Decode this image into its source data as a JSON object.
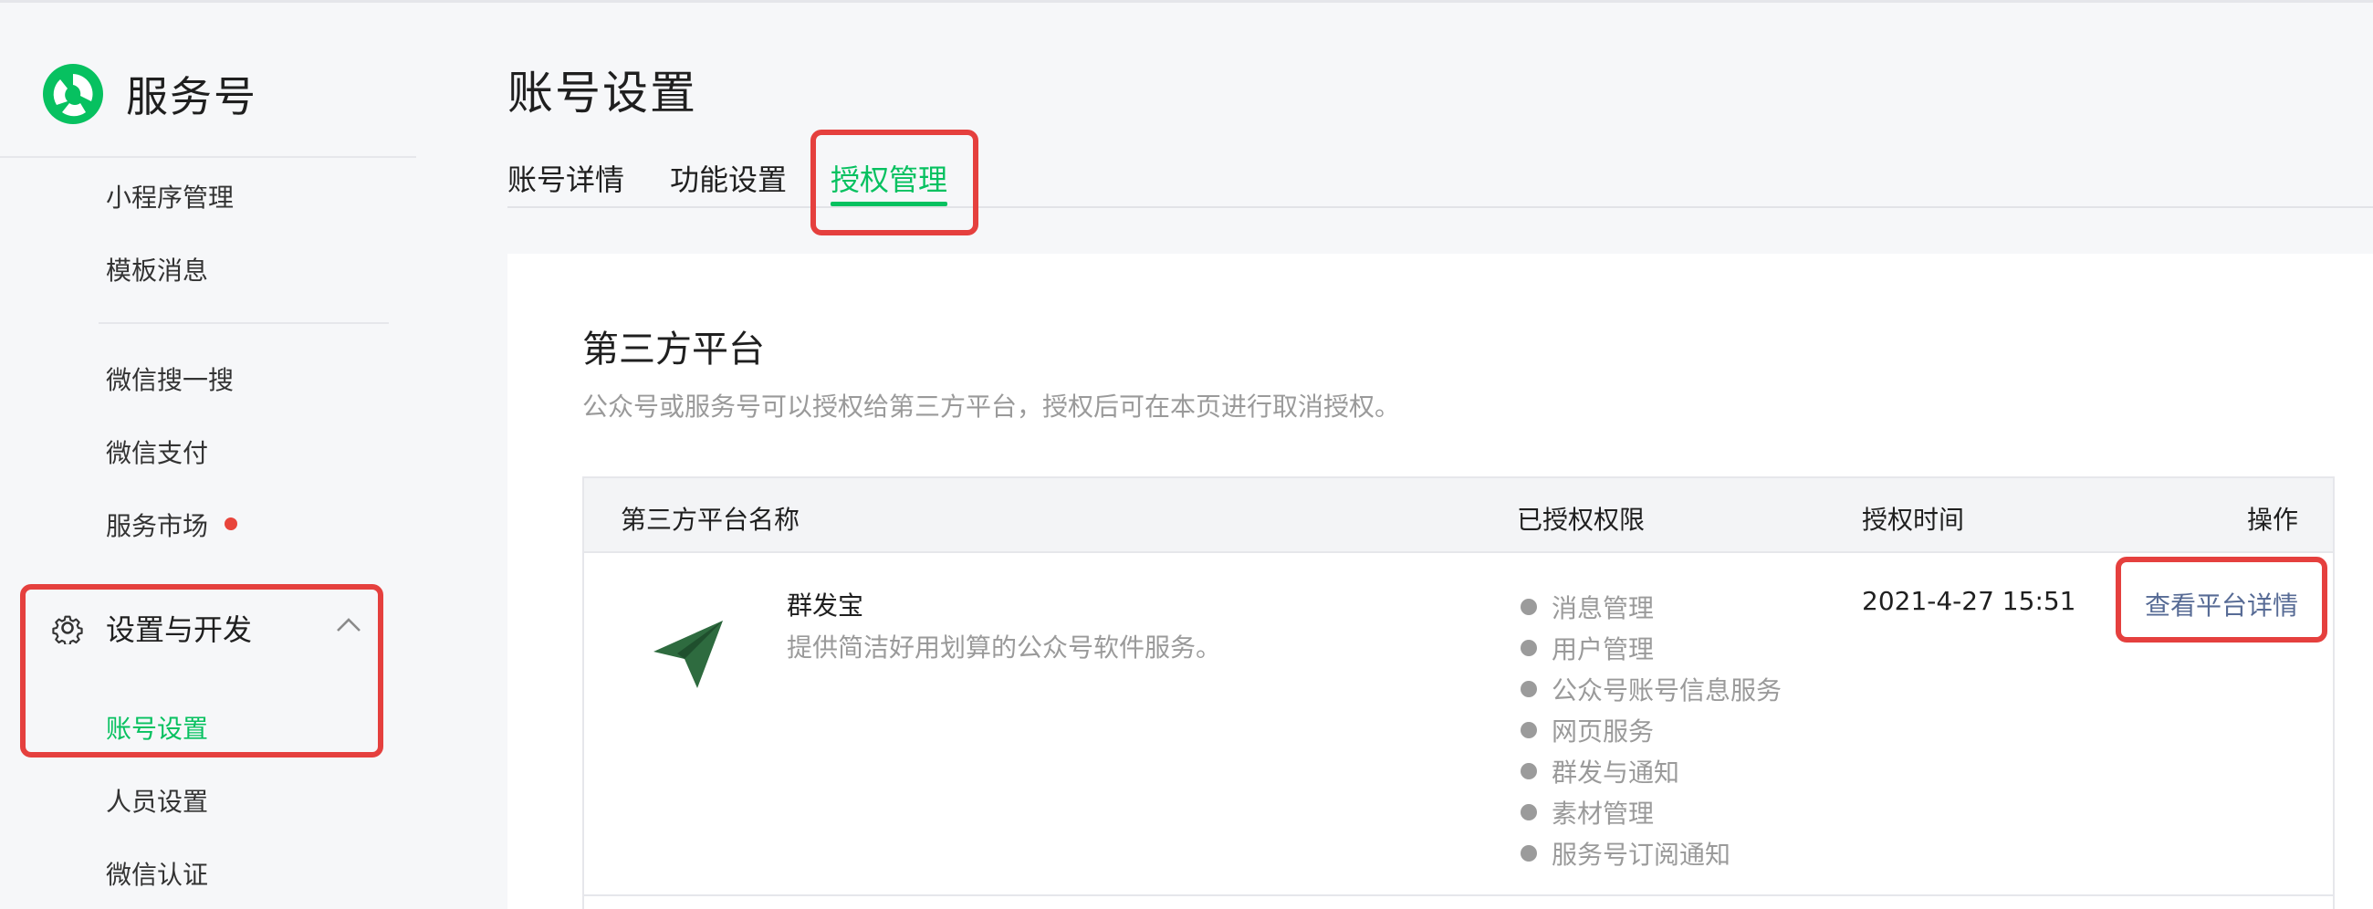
{
  "brand": {
    "name": "服务号"
  },
  "sidebar": {
    "items_top": [
      {
        "label": "小程序管理"
      },
      {
        "label": "模板消息"
      }
    ],
    "items_mid": [
      {
        "label": "微信搜一搜"
      },
      {
        "label": "微信支付"
      },
      {
        "label": "服务市场",
        "badge": true
      }
    ],
    "group": {
      "label": "设置与开发",
      "icon": "gear-icon",
      "expanded": true
    },
    "group_items": [
      {
        "label": "账号设置",
        "active": true
      },
      {
        "label": "人员设置"
      },
      {
        "label": "微信认证"
      }
    ]
  },
  "main": {
    "title": "账号设置",
    "tabs": [
      {
        "label": "账号详情"
      },
      {
        "label": "功能设置"
      },
      {
        "label": "授权管理",
        "active": true
      }
    ],
    "section": {
      "title": "第三方平台",
      "description": "公众号或服务号可以授权给第三方平台，授权后可在本页进行取消授权。"
    },
    "table": {
      "headers": [
        "第三方平台名称",
        "已授权权限",
        "授权时间",
        "操作"
      ],
      "rows": [
        {
          "name": "群发宝",
          "description": "提供简洁好用划算的公众号软件服务。",
          "permissions": [
            "消息管理",
            "用户管理",
            "公众号账号信息服务",
            "网页服务",
            "群发与通知",
            "素材管理",
            "服务号订阅通知"
          ],
          "auth_time": "2021-4-27 15:51",
          "action": "查看平台详情"
        }
      ]
    }
  },
  "colors": {
    "accent": "#07c160",
    "link": "#576b95",
    "highlight": "#e5403e",
    "badge": "#e8453c"
  }
}
